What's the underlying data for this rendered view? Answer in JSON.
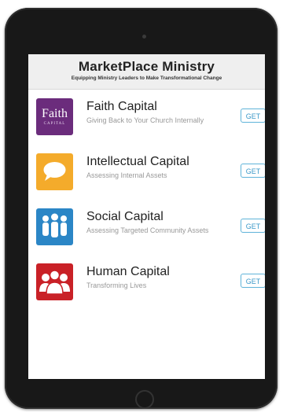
{
  "header": {
    "title": "MarketPlace Ministry",
    "subtitle": "Equipping Ministry Leaders to Make Transformational Change"
  },
  "apps": [
    {
      "name": "Faith Capital",
      "description": "Giving Back to Your Church Internally",
      "button": "GET",
      "icon": "faith-logo-icon",
      "icon_text": "Faith",
      "icon_subtext": "CAPITAL",
      "color": "#6b2c7c"
    },
    {
      "name": "Intellectual Capital",
      "description": "Assessing Internal Assets",
      "button": "GET",
      "icon": "speech-bubble-icon",
      "color": "#f4ab2b"
    },
    {
      "name": "Social Capital",
      "description": "Assessing Targeted Community Assets",
      "button": "GET",
      "icon": "people-group-icon",
      "color": "#2b86c6"
    },
    {
      "name": "Human Capital",
      "description": "Transforming Lives",
      "button": "GET",
      "icon": "people-group-icon",
      "color": "#c92127"
    }
  ],
  "accent_color": "#3a98c8"
}
